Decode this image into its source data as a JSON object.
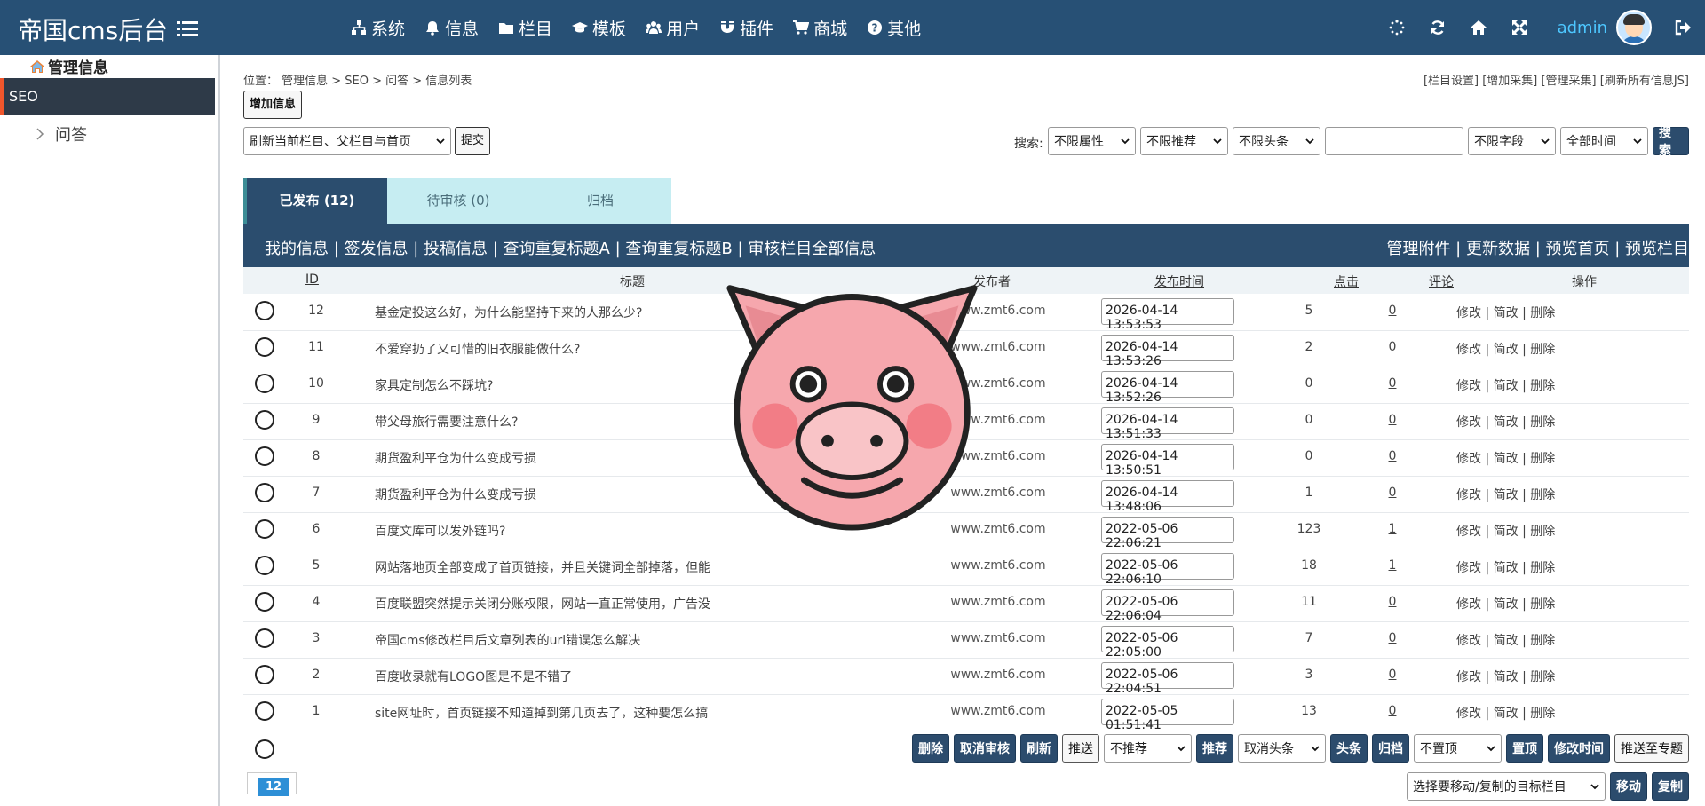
{
  "app": {
    "title": "帝国cms后台"
  },
  "topnav": [
    {
      "label": "系统",
      "icon": "sitemap-icon"
    },
    {
      "label": "信息",
      "icon": "bell-icon"
    },
    {
      "label": "栏目",
      "icon": "folder-icon"
    },
    {
      "label": "模板",
      "icon": "graduation-cap-icon"
    },
    {
      "label": "用户",
      "icon": "users-icon"
    },
    {
      "label": "插件",
      "icon": "magnet-icon"
    },
    {
      "label": "商城",
      "icon": "cart-icon"
    },
    {
      "label": "其他",
      "icon": "question-icon"
    }
  ],
  "user": {
    "name": "admin"
  },
  "sidebar": {
    "header": "管理信息",
    "active": "SEO",
    "items": [
      {
        "label": "问答"
      }
    ]
  },
  "breadcrumb": {
    "text": "位置： 管理信息 > SEO > 问答 > 信息列表"
  },
  "toplinks": "[栏目设置] [增加采集] [管理采集] [刷新所有信息JS]",
  "toolbar": {
    "add_label": "增加信息",
    "refresh_select": "刷新当前栏目、父栏目与首页",
    "submit_label": "提交"
  },
  "search": {
    "label": "搜索:",
    "attr": "不限属性",
    "recommend": "不限推荐",
    "headline": "不限头条",
    "field": "不限字段",
    "time": "全部时间",
    "button": "搜索",
    "value": ""
  },
  "tabs": [
    {
      "label": "已发布 (12)"
    },
    {
      "label": "待审核 (0)"
    },
    {
      "label": "归档"
    }
  ],
  "actionbar": {
    "left": [
      "我的信息",
      "签发信息",
      "投稿信息",
      "查询重复标题A",
      "查询重复标题B",
      "审核栏目全部信息"
    ],
    "right": [
      "管理附件",
      "更新数据",
      "预览首页",
      "预览栏目"
    ]
  },
  "table": {
    "headers": {
      "id": "ID",
      "title": "标题",
      "publisher": "发布者",
      "time": "发布时间",
      "clicks": "点击",
      "comments": "评论",
      "ops": "操作"
    },
    "ops": {
      "edit": "修改",
      "quick_edit": "简改",
      "delete": "删除"
    },
    "rows": [
      {
        "id": "12",
        "title": "基金定投这么好，为什么能坚持下来的人那么少?",
        "publisher": "www.zmt6.com",
        "time": "2026-04-14 13:53:53",
        "clicks": "5",
        "comments": "0"
      },
      {
        "id": "11",
        "title": "不爱穿扔了又可惜的旧衣服能做什么?",
        "publisher": "www.zmt6.com",
        "time": "2026-04-14 13:53:26",
        "clicks": "2",
        "comments": "0"
      },
      {
        "id": "10",
        "title": "家具定制怎么不踩坑?",
        "publisher": "www.zmt6.com",
        "time": "2026-04-14 13:52:26",
        "clicks": "0",
        "comments": "0"
      },
      {
        "id": "9",
        "title": "带父母旅行需要注意什么?",
        "publisher": "www.zmt6.com",
        "time": "2026-04-14 13:51:33",
        "clicks": "0",
        "comments": "0"
      },
      {
        "id": "8",
        "title": "期货盈利平仓为什么变成亏损",
        "publisher": "www.zmt6.com",
        "time": "2026-04-14 13:50:51",
        "clicks": "0",
        "comments": "0"
      },
      {
        "id": "7",
        "title": "期货盈利平仓为什么变成亏损",
        "publisher": "www.zmt6.com",
        "time": "2026-04-14 13:48:06",
        "clicks": "1",
        "comments": "0"
      },
      {
        "id": "6",
        "title": "百度文库可以发外链吗?",
        "publisher": "www.zmt6.com",
        "time": "2022-05-06 22:06:21",
        "clicks": "123",
        "comments": "1"
      },
      {
        "id": "5",
        "title": "网站落地页全部变成了首页链接，并且关键词全部掉落，但能",
        "publisher": "www.zmt6.com",
        "time": "2022-05-06 22:06:10",
        "clicks": "18",
        "comments": "1"
      },
      {
        "id": "4",
        "title": "百度联盟突然提示关闭分账权限，网站一直正常使用，广告没",
        "publisher": "www.zmt6.com",
        "time": "2022-05-06 22:06:04",
        "clicks": "11",
        "comments": "0"
      },
      {
        "id": "3",
        "title": "帝国cms修改栏目后文章列表的url错误怎么解决",
        "publisher": "www.zmt6.com",
        "time": "2022-05-06 22:05:00",
        "clicks": "7",
        "comments": "0"
      },
      {
        "id": "2",
        "title": "百度收录就有LOGO图是不是不错了",
        "publisher": "www.zmt6.com",
        "time": "2022-05-06 22:04:51",
        "clicks": "3",
        "comments": "0"
      },
      {
        "id": "1",
        "title": "site网址时，首页链接不知道掉到第几页去了，这种要怎么搞",
        "publisher": "www.zmt6.com",
        "time": "2022-05-05 01:51:41",
        "clicks": "13",
        "comments": "0"
      }
    ]
  },
  "bottom": {
    "delete": "删除",
    "cancel_review": "取消审核",
    "refresh": "刷新",
    "push": "推送",
    "recommend_select": "不推荐",
    "recommend_btn": "推荐",
    "headline_select": "取消头条",
    "headline_btn": "头条",
    "archive_btn": "归档",
    "top_select": "不置顶",
    "top_btn": "置顶",
    "modify_time": "修改时间",
    "push_topic": "推送至专题",
    "move_select": "选择要移动/复制的目标栏目",
    "move_btn": "移动",
    "copy_btn": "复制"
  },
  "pagination": {
    "current": "12"
  },
  "colors": {
    "header": "#275075",
    "accent": "#f0562c",
    "tab_active": "#2b4d6e",
    "tab_inactive": "#c6edf2"
  }
}
